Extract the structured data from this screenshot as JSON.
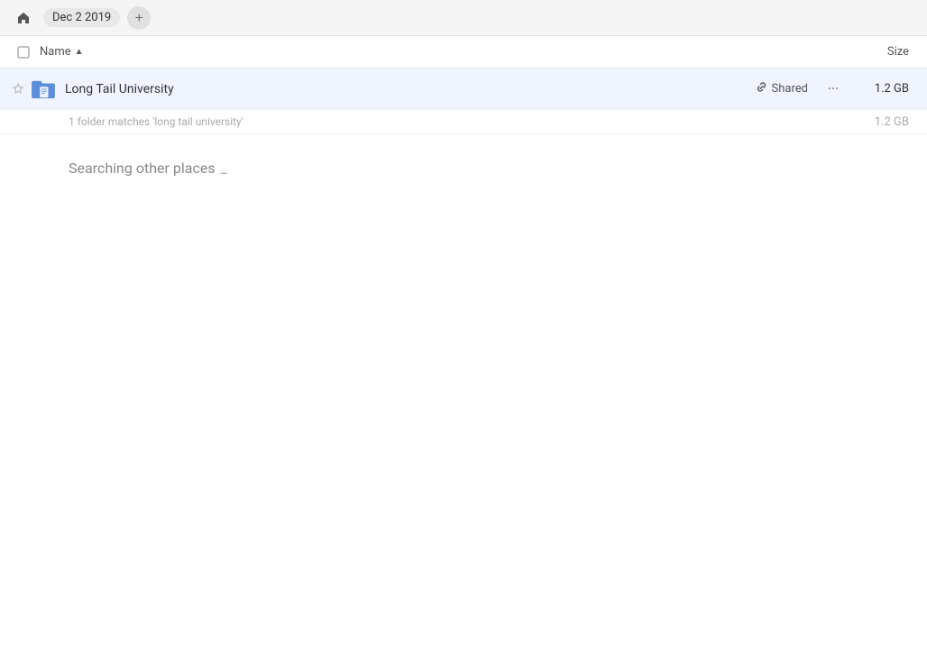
{
  "topbar": {
    "home_icon": "⌂",
    "breadcrumb_label": "Dec 2 2019",
    "add_icon": "+"
  },
  "columns": {
    "name_label": "Name",
    "sort_arrow": "▲",
    "size_label": "Size"
  },
  "file_row": {
    "name": "Long Tail University",
    "shared_label": "Shared",
    "size": "1.2 GB",
    "more_icon": "···"
  },
  "match_info": {
    "text": "1 folder matches 'long tail university'",
    "size": "1.2 GB"
  },
  "searching": {
    "label": "Searching other places",
    "loading": "_"
  }
}
